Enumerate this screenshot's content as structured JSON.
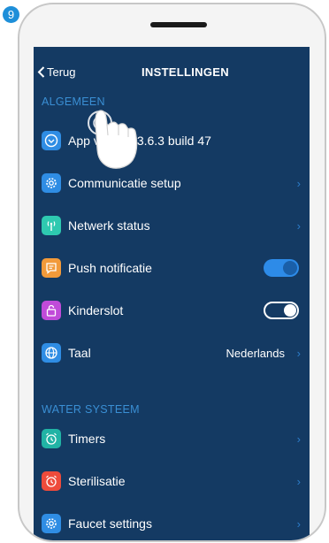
{
  "step_number": "9",
  "header": {
    "back_label": "Terug",
    "title": "INSTELLINGEN"
  },
  "sections": {
    "general": {
      "label": "ALGEMEEN"
    },
    "water": {
      "label": "WATER SYSTEEM"
    }
  },
  "items": {
    "app_version": {
      "label": "App version 3.6.3 build 47",
      "icon": "chevron-circle-icon",
      "color": "#2f8de4"
    },
    "communicatie": {
      "label": "Communicatie setup",
      "icon": "gear-icon",
      "color": "#2f8de4"
    },
    "netwerk": {
      "label": "Netwerk status",
      "icon": "antenna-icon",
      "color": "#2ec9b0"
    },
    "push": {
      "label": "Push notificatie",
      "icon": "chat-bubble-icon",
      "color": "#f29a3a",
      "enabled": true
    },
    "kinderslot": {
      "label": "Kinderslot",
      "icon": "lock-icon",
      "color": "#c04bd9",
      "enabled": false
    },
    "taal": {
      "label": "Taal",
      "value": "Nederlands",
      "icon": "globe-icon",
      "color": "#2f8de4"
    },
    "timers": {
      "label": "Timers",
      "icon": "alarm-clock-icon",
      "color": "#21b3a5"
    },
    "sterilisatie": {
      "label": "Sterilisatie",
      "icon": "alarm-clock-icon",
      "color": "#ee4b3b"
    },
    "faucet": {
      "label": "Faucet settings",
      "icon": "gear-icon",
      "color": "#2f8de4"
    }
  },
  "colors": {
    "screen_bg": "#143a63",
    "accent": "#2d8be8",
    "section_label": "#3a8fd4"
  }
}
